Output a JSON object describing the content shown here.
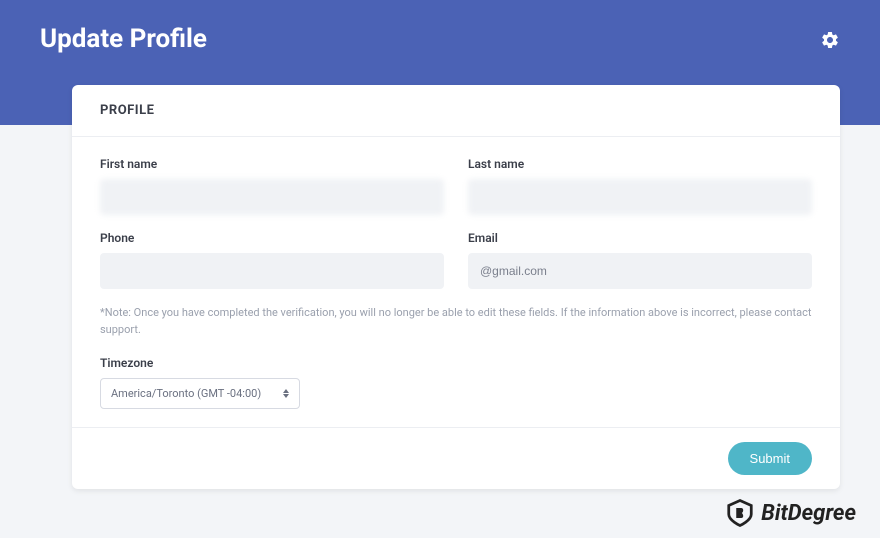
{
  "header": {
    "title": "Update Profile"
  },
  "card": {
    "section_title": "PROFILE",
    "fields": {
      "first_name": {
        "label": "First name",
        "value": ""
      },
      "last_name": {
        "label": "Last name",
        "value": ""
      },
      "phone": {
        "label": "Phone",
        "value": ""
      },
      "email": {
        "label": "Email",
        "value": "@gmail.com"
      }
    },
    "note": "*Note: Once you have completed the verification, you will no longer be able to edit these fields. If the information above is incorrect, please contact support.",
    "timezone": {
      "label": "Timezone",
      "selected": "America/Toronto (GMT -04:00)"
    },
    "submit_label": "Submit"
  },
  "watermark": {
    "brand": "BitDegree"
  }
}
